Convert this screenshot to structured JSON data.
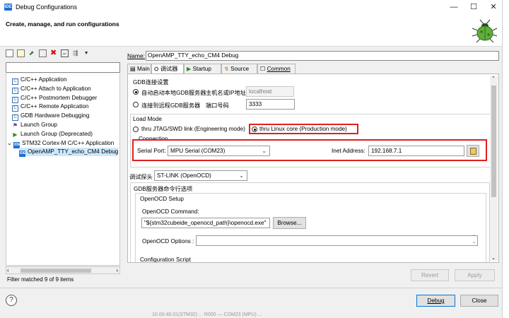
{
  "window": {
    "title": "Debug Configurations",
    "app_icon_text": "IDE",
    "minimize": "—",
    "maximize": "☐",
    "close": "✕"
  },
  "header": {
    "title": "Create, manage, and run configurations"
  },
  "left": {
    "filter_value": "",
    "tree": [
      {
        "label": "C/C++ Application",
        "icon": "c-icon",
        "indent": 0
      },
      {
        "label": "C/C++ Attach to Application",
        "icon": "c-icon",
        "indent": 0
      },
      {
        "label": "C/C++ Postmortem Debugger",
        "icon": "c-icon",
        "indent": 0
      },
      {
        "label": "C/C++ Remote Application",
        "icon": "c-icon",
        "indent": 0
      },
      {
        "label": "GDB Hardware Debugging",
        "icon": "c-icon",
        "indent": 0
      },
      {
        "label": "Launch Group",
        "icon": "launch-group-icon",
        "indent": 0
      },
      {
        "label": "Launch Group (Deprecated)",
        "icon": "play-icon",
        "indent": 0
      },
      {
        "label": "STM32 Cortex-M C/C++ Application",
        "icon": "ide-icon",
        "indent": 0
      },
      {
        "label": "OpenAMP_TTY_echo_CM4 Debug",
        "icon": "ide-icon",
        "indent": 1
      }
    ],
    "filter_status": "Filter matched 9 of 9 items"
  },
  "right": {
    "name_label": "Name:",
    "name_value": "OpenAMP_TTY_echo_CM4 Debug",
    "tabs": [
      "Main",
      "调试器",
      "Startup",
      "Source",
      "Common"
    ],
    "gdb_section": "GDB连接设置",
    "local_gdb_label": "自动启动本地GDB服务器",
    "host_label": "主机名或IP地址",
    "host_value": "localhost",
    "remote_gdb_label": "连接到远程GDB服务器",
    "port_label": "端口号码",
    "port_value": "3333",
    "load_mode_label": "Load Mode",
    "jtag_label": "thru JTAG/SWD link (Engineering mode)",
    "linux_label": "thru Linux core (Production mode)",
    "connection_label": "Connection",
    "serial_port_label": "Serial Port:",
    "serial_port_value": "MPU Serial (COM23)",
    "inet_label": "Inet Address:",
    "inet_value": "192.168.7.1",
    "probe_label": "调试探头",
    "probe_value": "ST-LINK (OpenOCD)",
    "gdb_cmd_label": "GDB服务器命令行选项",
    "openocd_setup": "OpenOCD Setup",
    "openocd_cmd_label": "OpenOCD Command:",
    "openocd_cmd_value": "\"${stm32cubeide_openocd_path}\\openocd.exe\"",
    "browse": "Browse...",
    "openocd_options_label": "OpenOCD Options :",
    "config_script_label": "Configuration Script",
    "revert": "Revert",
    "apply": "Apply"
  },
  "footer": {
    "debug": "Debug",
    "close": "Close",
    "help": "?",
    "under_text": "10.00:40.01(STM32) ... R000 — COM23 (MPU) ..."
  },
  "colors": {
    "highlight_box": "#e02020",
    "selection": "#cce8ff",
    "accent": "#0078d7"
  }
}
